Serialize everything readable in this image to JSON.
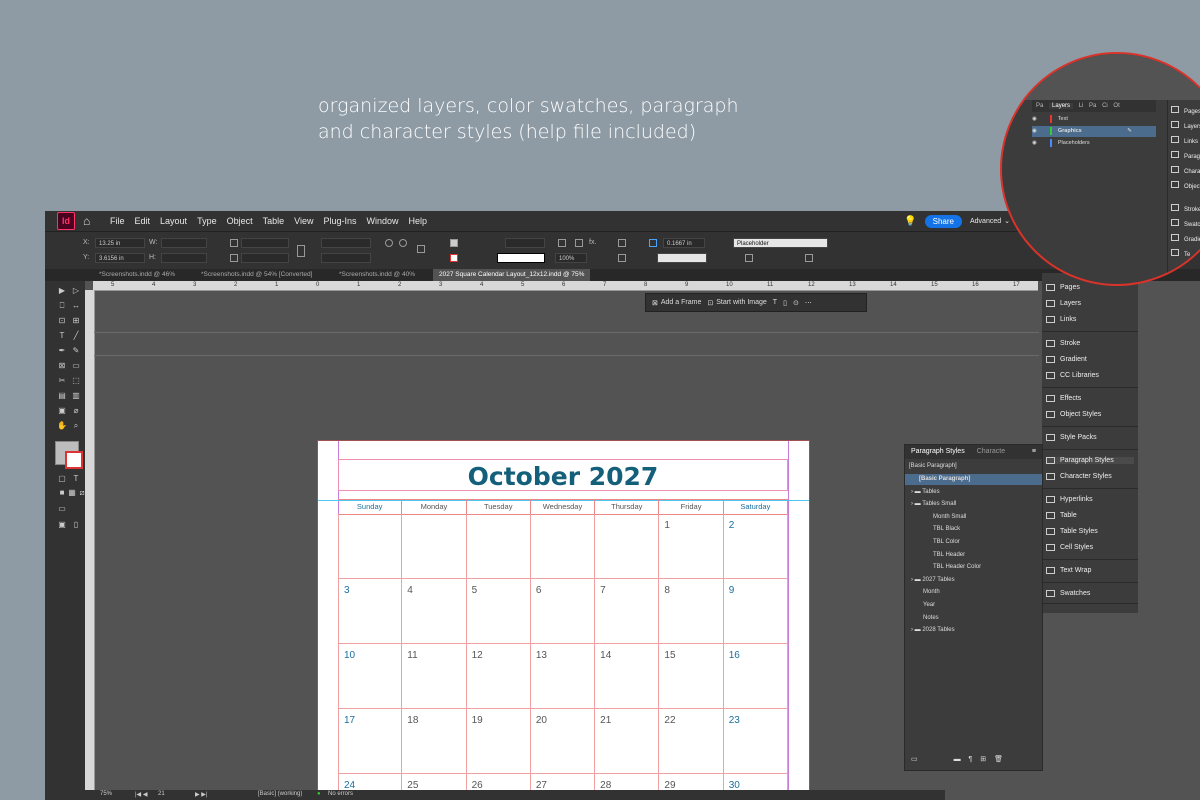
{
  "caption": {
    "line1": "organized layers, color swatches, paragraph",
    "line2": "and character styles (help file included)"
  },
  "menu": {
    "app_icon": "Id",
    "items": [
      "File",
      "Edit",
      "Layout",
      "Type",
      "Object",
      "Table",
      "View",
      "Plug-Ins",
      "Window",
      "Help"
    ],
    "share_label": "Share",
    "workspace": "Advanced"
  },
  "control": {
    "x_label": "X:",
    "x_value": "13.25 in",
    "y_label": "Y:",
    "y_value": "3.6156 in",
    "w_label": "W:",
    "h_label": "H:",
    "stroke_value": "0.1667 in",
    "style_value": "Placeholder",
    "zoom_value": "100%"
  },
  "tabs": [
    {
      "label": "*Screenshots.indd @ 46%"
    },
    {
      "label": "*Screenshots.indd @ 54% [Converted]"
    },
    {
      "label": "*Screenshots.indd @ 40%"
    },
    {
      "label": "2027 Square Calendar Layout_12x12.indd @ 75%"
    }
  ],
  "ruler": {
    "ticks": [
      "5",
      "4",
      "3",
      "2",
      "1",
      "0",
      "1",
      "2",
      "3",
      "4",
      "5",
      "6",
      "7",
      "8",
      "9",
      "10",
      "11",
      "12",
      "13",
      "14",
      "15",
      "16",
      "17"
    ]
  },
  "context_bar": {
    "add_frame": "Add a Frame",
    "start_image": "Start with Image"
  },
  "calendar": {
    "title": "October 2027",
    "weekdays": [
      "Sunday",
      "Monday",
      "Tuesday",
      "Wednesday",
      "Thursday",
      "Friday",
      "Saturday"
    ],
    "days": [
      "",
      "",
      "",
      "",
      "",
      "1",
      "2",
      "3",
      "4",
      "5",
      "6",
      "7",
      "8",
      "9",
      "10",
      "11",
      "12",
      "13",
      "14",
      "15",
      "16",
      "17",
      "18",
      "19",
      "20",
      "21",
      "22",
      "23",
      "24",
      "25",
      "26",
      "27",
      "28",
      "29",
      "30"
    ]
  },
  "panel_strip": {
    "items": [
      "Pages",
      "Layers",
      "Links",
      "Stroke",
      "Gradient",
      "CC Libraries",
      "Effects",
      "Object Styles",
      "Style Packs",
      "Paragraph Styles",
      "Character Styles",
      "Hyperlinks",
      "Table",
      "Table Styles",
      "Cell Styles",
      "Text Wrap",
      "Swatches"
    ]
  },
  "paragraph_styles": {
    "tab_active": "Paragraph Styles",
    "tab_inactive": "Characte",
    "current": "[Basic Paragraph]",
    "rows": [
      "[Basic Paragraph]",
      "Tables",
      "Tables Small",
      "Month Small",
      "TBL Black",
      "TBL Color",
      "TBL Header",
      "TBL Header Color",
      "2027 Tables",
      "Month",
      "Year",
      "Notes",
      "2028 Tables"
    ]
  },
  "status": {
    "zoom": "75%",
    "page": "21",
    "style": "[Basic] (working)",
    "errors": "No errors"
  },
  "zoom_callout": {
    "tabs": [
      "Pa",
      "Layers",
      "Li",
      "Pa",
      "Ci",
      "Ot"
    ],
    "layers": [
      "Text",
      "Graphics",
      "Placeholders"
    ],
    "right_items": [
      "Pages",
      "Layers",
      "Links",
      "Paragr",
      "Charac",
      "Object",
      "Stroke",
      "Swatch",
      "Gradie",
      "Te"
    ]
  },
  "colors": {
    "accent": "#1473e6",
    "title": "#14607a",
    "weekend": "#1a6fa0",
    "callout_border": "#d9332a",
    "selection": "#4b6c8c"
  }
}
